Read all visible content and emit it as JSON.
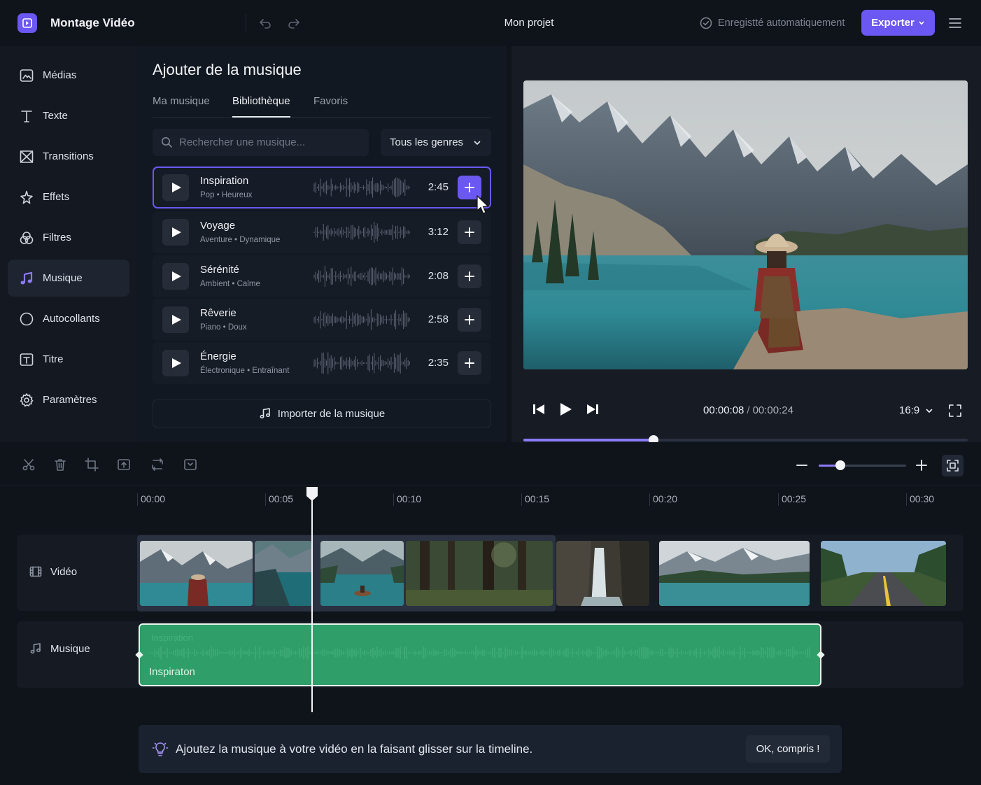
{
  "app": {
    "title": "Montage Vidéo",
    "project": "Mon projet",
    "autosave": "Enregistté automatiquement",
    "export_label": "Exporter",
    "accent": "#6b57f2"
  },
  "nav": {
    "items": [
      {
        "label": "Médias",
        "icon": "media-icon"
      },
      {
        "label": "Texte",
        "icon": "text-icon"
      },
      {
        "label": "Transitions",
        "icon": "transitions-icon"
      },
      {
        "label": "Effets",
        "icon": "effects-icon"
      },
      {
        "label": "Filtres",
        "icon": "filters-icon"
      },
      {
        "label": "Musique",
        "icon": "music-icon",
        "active": true
      },
      {
        "label": "Autocollants",
        "icon": "stickers-icon"
      },
      {
        "label": "Titre",
        "icon": "title-icon"
      },
      {
        "label": "Paramètres",
        "icon": "settings-icon"
      }
    ]
  },
  "music": {
    "title": "Ajouter de la musique",
    "tabs": [
      "Ma musique",
      "Bibliothèque",
      "Favoris"
    ],
    "active_tab": "Bibliothèque",
    "search_placeholder": "Rechercher une musique...",
    "genre_filter": "Tous les genres",
    "tracks": [
      {
        "name": "Inspiration",
        "meta": "Pop • Heureux",
        "duration": "2:45",
        "selected": true
      },
      {
        "name": "Voyage",
        "meta": "Aventure • Dynamique",
        "duration": "3:12"
      },
      {
        "name": "Sérénité",
        "meta": "Ambient • Calme",
        "duration": "2:08"
      },
      {
        "name": "Rêverie",
        "meta": "Piano • Doux",
        "duration": "2:58"
      },
      {
        "name": "Énergie",
        "meta": "Électronique • Entraînant",
        "duration": "2:35"
      }
    ],
    "import_label": "Importer de la musique"
  },
  "preview": {
    "current_time": "00:00:08",
    "separator": "/",
    "total_time": "00:00:24",
    "aspect_ratio": "16:9",
    "progress": 0.293
  },
  "timeline": {
    "ruler": [
      "00:00",
      "00:05",
      "00:10",
      "00:15",
      "00:20",
      "00:25",
      "00:30"
    ],
    "zoom_level": 0.25,
    "video_track_label": "Vidéo",
    "music_track_label": "Musique",
    "audio_clip_name": "Inspiraton",
    "audio_clip_ghost": "Inspiration",
    "audio_color": "#2f9e68"
  },
  "tip": {
    "text": "Ajoutez la musique à votre vidéo en la faisant glisser sur la timeline.",
    "ok_label": "OK, compris !"
  }
}
